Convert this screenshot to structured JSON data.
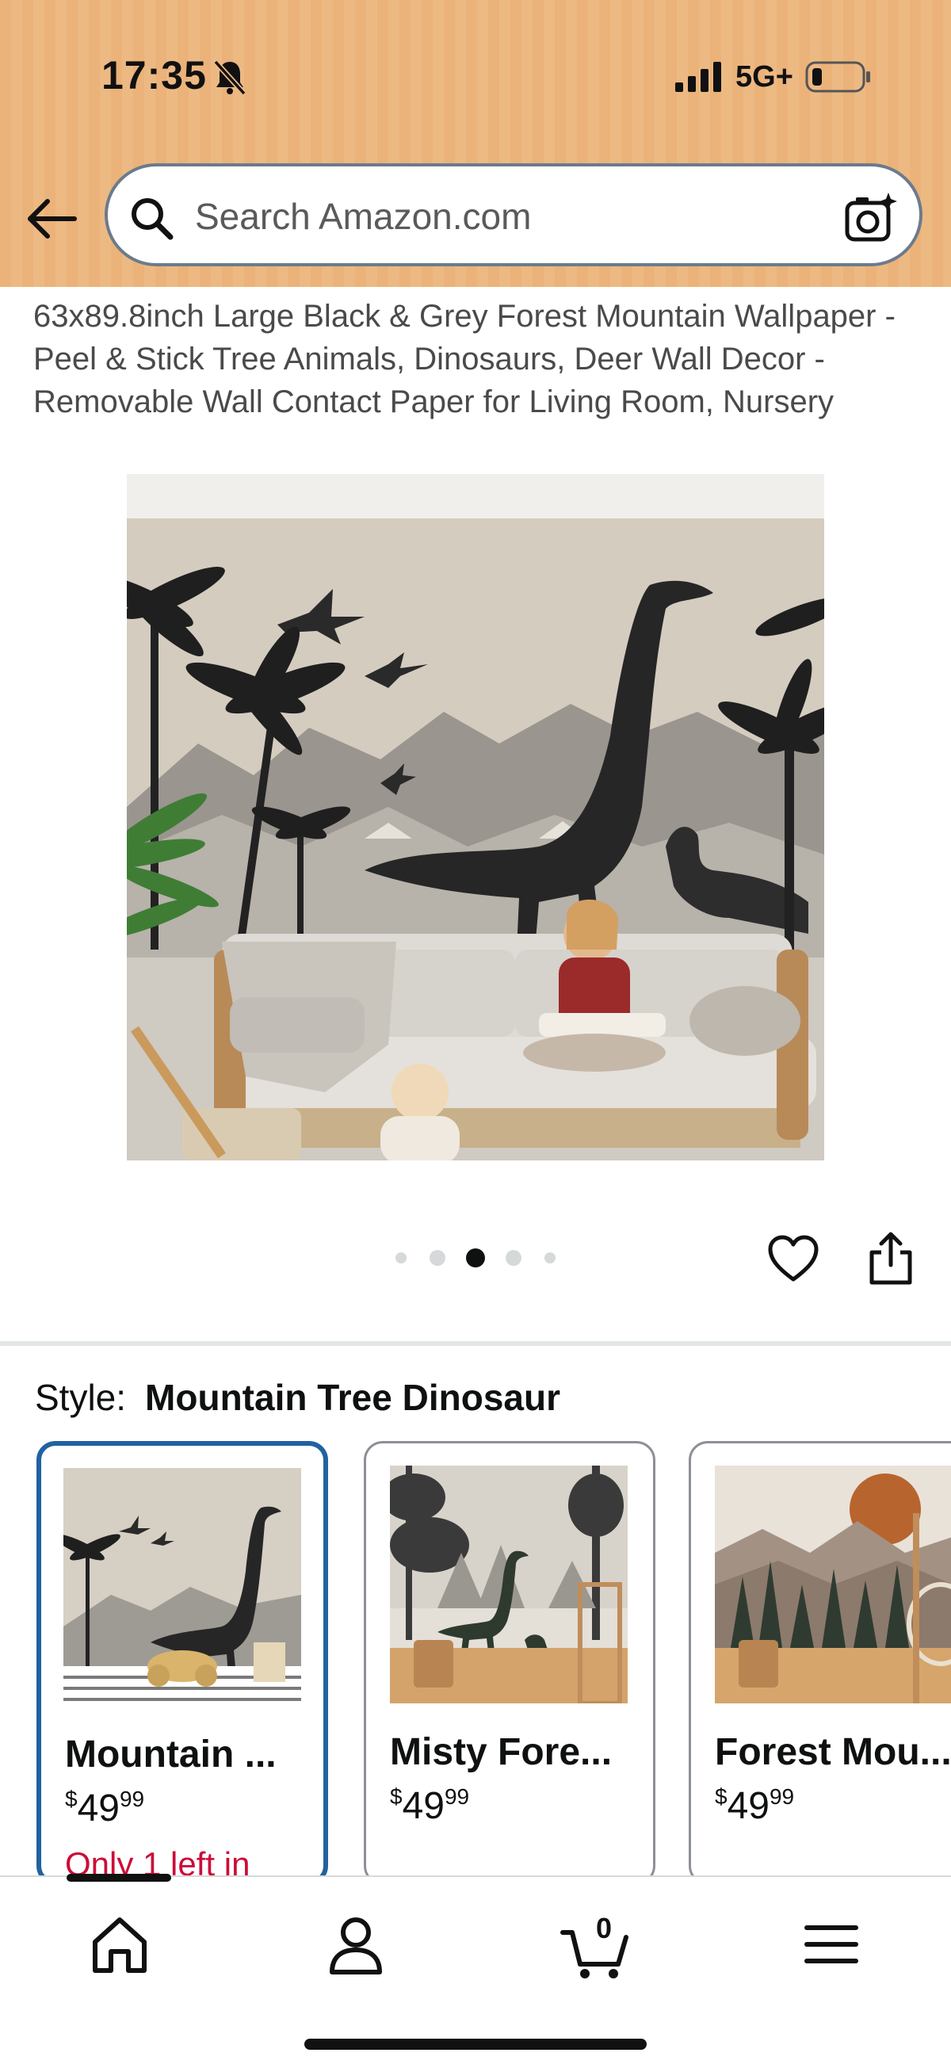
{
  "status_bar": {
    "time": "17:35",
    "network": "5G+"
  },
  "search": {
    "placeholder": "Search Amazon.com"
  },
  "product": {
    "title": "63x89.8inch Large Black & Grey Forest Mountain Wallpaper - Peel & Stick Tree Animals, Dinosaurs, Deer Wall Decor - Removable Wall Contact Paper for Living Room, Nursery",
    "image_count": 5,
    "image_selected_index": 2
  },
  "style_selector": {
    "label": "Style:",
    "selected_value": "Mountain Tree Dinosaur",
    "options": [
      {
        "name": "Mountain ...",
        "price_symbol": "$",
        "price_whole": "49",
        "price_fraction": "99",
        "stock": "Only 1 left in",
        "selected": true
      },
      {
        "name": "Misty Fore...",
        "price_symbol": "$",
        "price_whole": "49",
        "price_fraction": "99",
        "stock": "",
        "selected": false
      },
      {
        "name": "Forest Mou...",
        "price_symbol": "$",
        "price_whole": "49",
        "price_fraction": "99",
        "stock": "",
        "selected": false
      }
    ]
  },
  "bottom_nav": {
    "items": [
      "home-icon",
      "account-icon",
      "cart-icon",
      "menu-icon"
    ],
    "cart_count": "0"
  },
  "colors": {
    "header_bg": "#ebb27a",
    "selected_border": "#2162a1",
    "stock_warning": "#cc0c39"
  }
}
